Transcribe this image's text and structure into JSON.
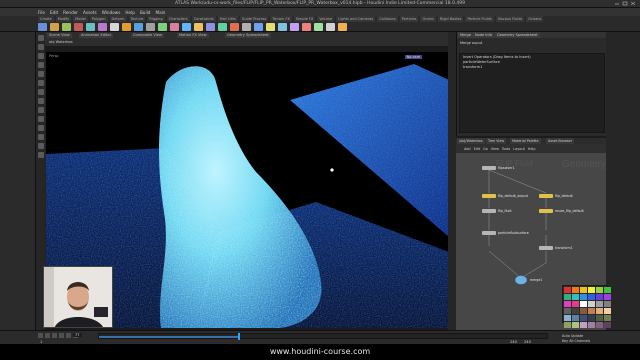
{
  "window": {
    "title": "ATLAS Work/udu-cs-work_files/FLIP/FLIP_PR_Waterbox/FLIP_PR_Waterbox_v014.hipb - Houdini Indie Limited-Commercial 18.0.499"
  },
  "menu": [
    "File",
    "Edit",
    "Render",
    "Assets",
    "Windows",
    "Help",
    "Build",
    "Main"
  ],
  "shelf_tabs": [
    "Create",
    "Modify",
    "Model",
    "Polygon",
    "Deform",
    "Texture",
    "Rigging",
    "Characters",
    "Constraints",
    "Hair Utils",
    "Guide Process",
    "Terrain FX",
    "Simple FX",
    "Volume",
    "Lights and Cameras",
    "Collisions",
    "Particles",
    "Grains",
    "Rigid Bodies",
    "Particle Fluids",
    "Viscous Fluids",
    "Oceans"
  ],
  "shelf_tool_colors": [
    "#6b8fd6",
    "#d0a24a",
    "#9ec25a",
    "#c25a5a",
    "#6ac0c0",
    "#b87ad0",
    "#d6d6d6",
    "#e0a030",
    "#58a0e0",
    "#a0a0a0",
    "#7fd07f",
    "#d87fa0",
    "#5fb8ff",
    "#f0c060",
    "#9090e0",
    "#60d0a0",
    "#e07050",
    "#b0b0b0",
    "#70a0f0",
    "#e0e070",
    "#80c0e0",
    "#c0a0f0",
    "#f08080",
    "#a0e0a0",
    "#d0d0d0",
    "#f0b050"
  ],
  "viewport": {
    "tabs": [
      "Scene View",
      "Animation Editor",
      "Composite View",
      "Motion FX View",
      "Geometry Spreadsheet"
    ],
    "path": "obj  Waterbox",
    "persp_label": "Persp",
    "camera_label": "No cam"
  },
  "params": {
    "tabs": [
      "Merge",
      "Node Info",
      "Geometry Spreadsheet"
    ],
    "header": "Merge  ouput",
    "row1": "Insert Operators (Drag Items to Insert)",
    "row2": "particleWaterSurface",
    "row3": "transform1"
  },
  "network": {
    "tabs": [
      "/obj/Waterbox",
      "Tree View",
      "Material Palette",
      "Asset Browser"
    ],
    "menu": [
      "Add",
      "Edit",
      "Go",
      "View",
      "Tools",
      "Layout",
      "Help"
    ],
    "watermark1": "Geometry",
    "watermark2": "FLIP Fluid",
    "nodes": [
      {
        "label": "flipsolver1",
        "sub": "",
        "color": "#b5b5b5"
      },
      {
        "label": "flip_default_output",
        "sub": "",
        "color": "#e0c24a"
      },
      {
        "label": "flip_fluid",
        "sub": "",
        "color": "#b5b5b5"
      },
      {
        "label": "flip_default",
        "sub": "",
        "color": "#e0c24a"
      },
      {
        "label": "resize_flip_default",
        "sub": "",
        "color": "#e0c24a"
      },
      {
        "label": "particlefluidsurface",
        "sub": "",
        "color": "#b5b5b5"
      },
      {
        "label": "transform1",
        "sub": "",
        "color": "#b5b5b5"
      },
      {
        "label": "merge1",
        "sub": "",
        "color": "#b5b5b5"
      }
    ]
  },
  "palette": [
    "#e03030",
    "#f07a20",
    "#f0c020",
    "#f0f040",
    "#9ad040",
    "#40c040",
    "#30b080",
    "#30c0c0",
    "#3090e0",
    "#3060e0",
    "#6040e0",
    "#a040e0",
    "#e040c0",
    "#e04080",
    "#ffffff",
    "#d0d0d0",
    "#a0a0a0",
    "#808080",
    "#606060",
    "#404040",
    "#8a5a3a",
    "#c08050",
    "#e0b080",
    "#f0d0a0",
    "#90b0d0",
    "#6080a0",
    "#405070",
    "#304050",
    "#506040",
    "#708050",
    "#90a060",
    "#b0c080",
    "#c0a0c0",
    "#a080a0",
    "#806080",
    "#604060"
  ],
  "timeline": {
    "frame": "77",
    "start": "1",
    "end": "240",
    "end2": "240",
    "progress": 0.31,
    "right1": "Auto Update",
    "right2": "Key All Channels"
  },
  "footer_url": "www.houdini-course.com"
}
